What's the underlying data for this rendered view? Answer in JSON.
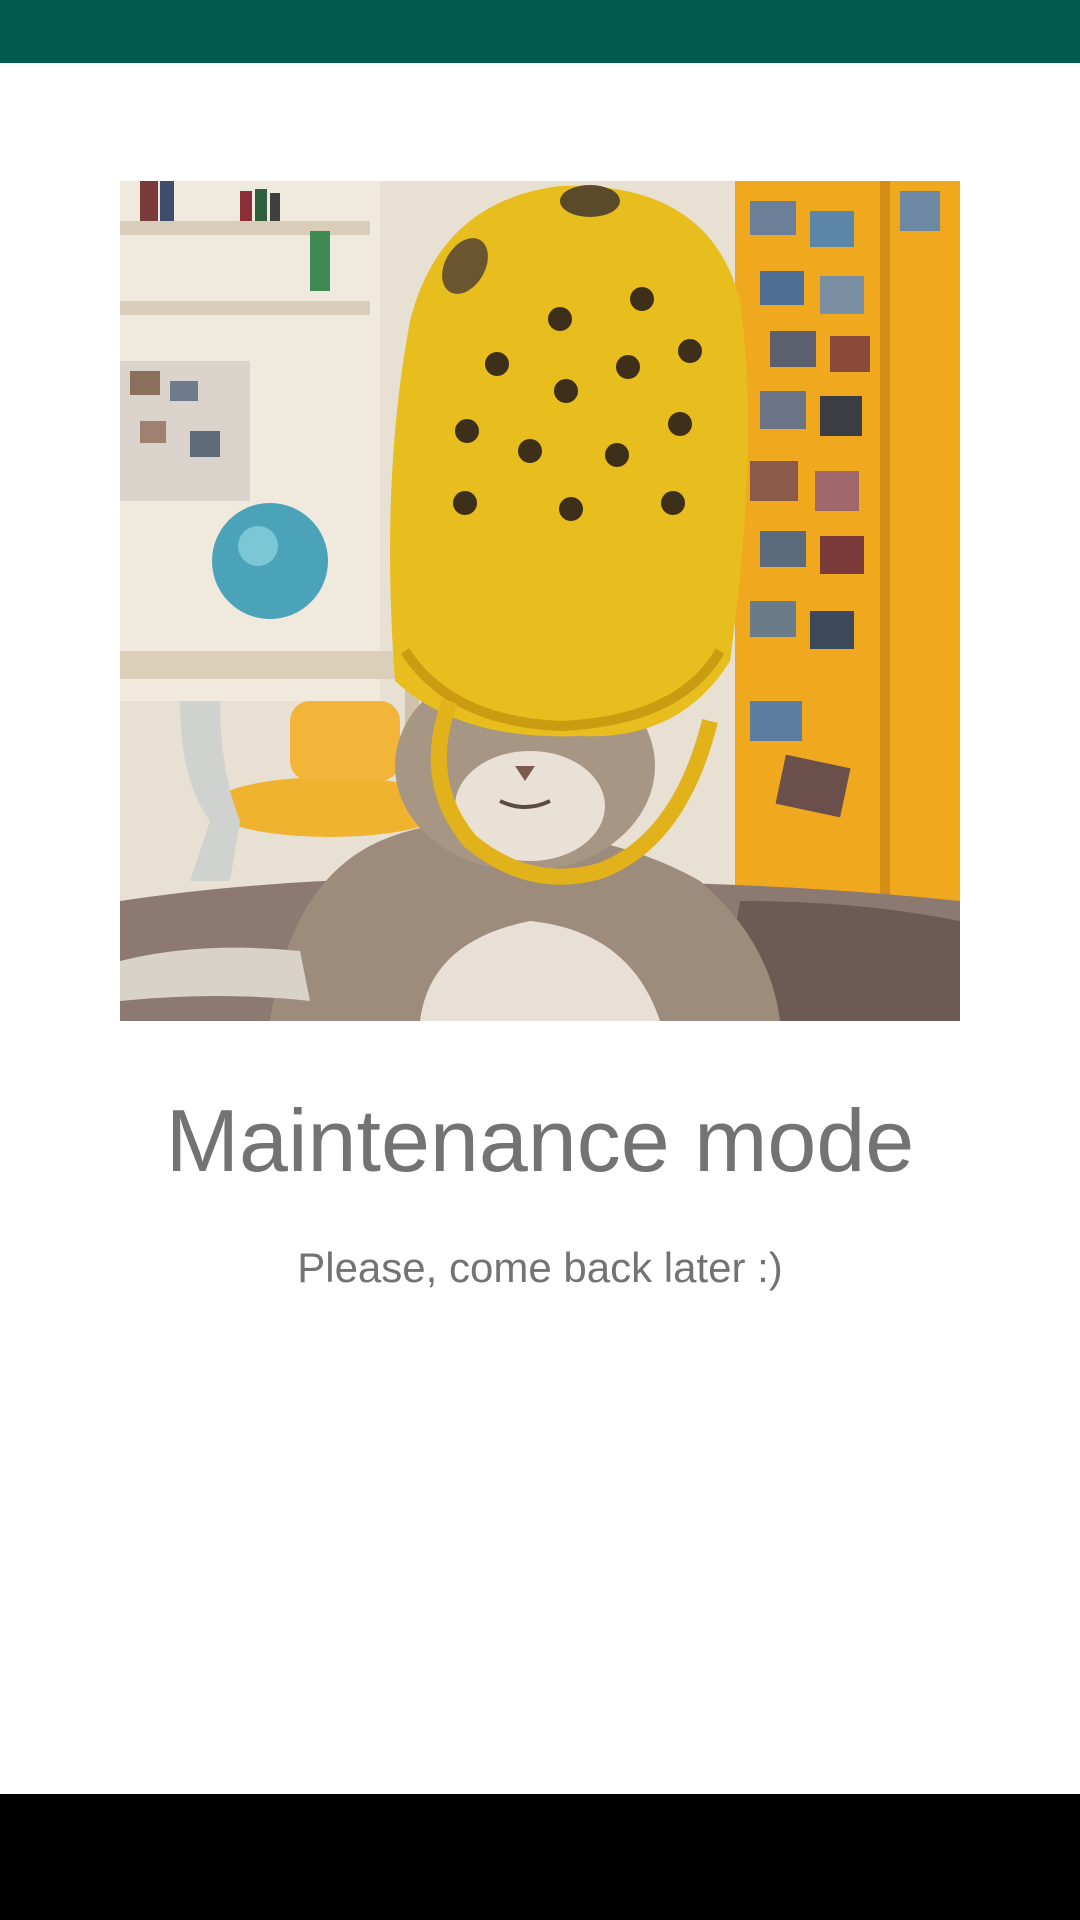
{
  "colors": {
    "status_bar": "#005a4d",
    "background": "#ffffff",
    "text": "#737373",
    "nav_bar": "#000000"
  },
  "maintenance": {
    "title": "Maintenance mode",
    "subtitle": "Please, come back later :)"
  },
  "image": {
    "icon": "cat-wearing-yellow-clog-photo"
  }
}
